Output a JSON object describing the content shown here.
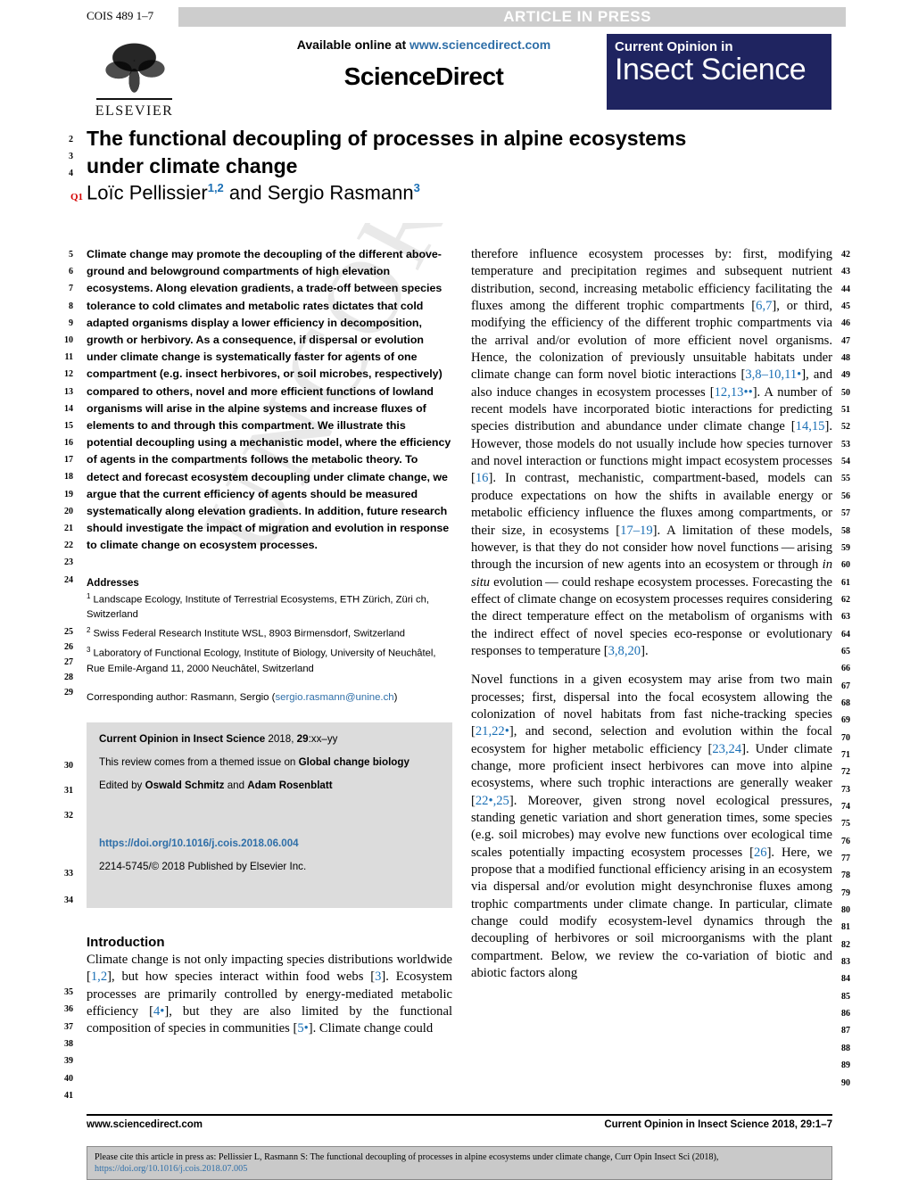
{
  "header": {
    "cois_code": "COIS 489 1–7",
    "article_in_press": "ARTICLE IN PRESS",
    "available_online_prefix": "Available online at ",
    "sciencedirect_url": "www.sciencedirect.com",
    "sciencedirect_wordmark": "ScienceDirect",
    "elsevier_name": "ELSEVIER",
    "journal_logo_line1": "Current Opinion in",
    "journal_logo_line2": "Insect Science",
    "colors": {
      "link_blue": "#2f6fa8",
      "ref_blue": "#1a6fb5",
      "logo_navy": "#1f2460",
      "bar_gray": "#cdcdcd",
      "box_gray": "#dcdcdc",
      "query_red": "#d40000"
    }
  },
  "article": {
    "title": "The functional decoupling of processes in alpine ecosystems under climate change",
    "authors_html": "Loïc Pellissier<sup>1,2</sup> and Sergio Rasmann<sup>3</sup>",
    "query_marker": "Q1",
    "watermark": "UNCORRECTED PROOF"
  },
  "abstract": {
    "text": "Climate change may promote the decoupling of the different above-ground and belowground compartments of high elevation ecosystems. Along elevation gradients, a trade-off between species tolerance to cold climates and metabolic rates dictates that cold adapted organisms display a lower efficiency in decomposition, growth or herbivory. As a consequence, if dispersal or evolution under climate change is systematically faster for agents of one compartment (e.g. insect herbivores, or soil microbes, respectively) compared to others, novel and more efficient functions of lowland organisms will arise in the alpine systems and increase fluxes of elements to and through this compartment. We illustrate this potential decoupling using a mechanistic model, where the efficiency of agents in the compartments follows the metabolic theory. To detect and forecast ecosystem decoupling under climate change, we argue that the current efficiency of agents should be measured systematically along elevation gradients. In addition, future research should investigate the impact of migration and evolution in response to climate change on ecosystem processes."
  },
  "addresses": {
    "heading": "Addresses",
    "items": [
      {
        "sup": "1",
        "text": " Landscape Ecology, Institute of Terrestrial Ecosystems, ETH Zürich, Züri ch, Switzerland"
      },
      {
        "sup": "2",
        "text": " Swiss Federal Research Institute WSL, 8903 Birmensdorf, Switzerland"
      },
      {
        "sup": "3",
        "text": " Laboratory of Functional Ecology, Institute of Biology, University of Neuchâtel, Rue Emile-Argand 11, 2000 Neuchâtel, Switzerland"
      }
    ],
    "corresponding_prefix": "Corresponding author: Rasmann, Sergio (",
    "corresponding_email": "sergio.rasmann@unine.ch",
    "corresponding_suffix": ")"
  },
  "journal_box": {
    "citation_bold": "Current Opinion in Insect Science",
    "citation_rest": " 2018, ",
    "citation_vol": "29",
    "citation_pages": ":xx–yy",
    "themed_prefix": "This review comes from a themed issue on ",
    "themed_bold": "Global change biology",
    "edited_prefix": "Edited by ",
    "editor1": "Oswald Schmitz",
    "edited_join": " and ",
    "editor2": "Adam Rosenblatt",
    "doi": "https://doi.org/10.1016/j.cois.2018.06.004",
    "issn_line": "2214-5745/© 2018 Published by Elsevier Inc."
  },
  "introduction": {
    "heading": "Introduction",
    "paragraph_parts": [
      {
        "t": "Climate change is not only impacting species distributions worldwide ["
      },
      {
        "t": "1,2",
        "ref": true
      },
      {
        "t": "], but how species interact within food webs ["
      },
      {
        "t": "3",
        "ref": true
      },
      {
        "t": "]. Ecosystem processes are primarily controlled by energy-mediated metabolic efficiency ["
      },
      {
        "t": "4•",
        "ref": true
      },
      {
        "t": "], but they are also limited by the functional composition of species in communities ["
      },
      {
        "t": "5•",
        "ref": true
      },
      {
        "t": "]. Climate change could"
      }
    ]
  },
  "right_column": {
    "para1_parts": [
      {
        "t": "therefore influence ecosystem processes by: first, modifying temperature and precipitation regimes and subsequent nutrient distribution, second, increasing metabolic efficiency facilitating the fluxes among the different trophic compartments ["
      },
      {
        "t": "6,7",
        "ref": true
      },
      {
        "t": "], or third, modifying the efficiency of the different trophic compartments via the arrival and/or evolution of more efficient novel organisms. Hence, the colonization of previously unsuitable habitats under climate change can form novel biotic interactions ["
      },
      {
        "t": "3,8–10,11•",
        "ref": true
      },
      {
        "t": "], and also induce changes in ecosystem processes ["
      },
      {
        "t": "12,13••",
        "ref": true
      },
      {
        "t": "]. A number of recent models have incorporated biotic interactions for predicting species distribution and abundance under climate change ["
      },
      {
        "t": "14,15",
        "ref": true
      },
      {
        "t": "]. However, those models do not usually include how species turnover and novel interaction or functions might impact ecosystem processes ["
      },
      {
        "t": "16",
        "ref": true
      },
      {
        "t": "]. In contrast, mechanistic, compartment-based, models can produce expectations on how the shifts in available energy or metabolic efficiency influence the fluxes among compartments, or their size, in ecosystems ["
      },
      {
        "t": "17–19",
        "ref": true
      },
      {
        "t": "]. A limitation of these models, however, is that they do not consider how novel functions — arising through the incursion of new agents into an ecosystem or through "
      },
      {
        "t": "in situ",
        "ital": true
      },
      {
        "t": " evolution — could reshape ecosystem processes. Forecasting the effect of climate change on ecosystem processes requires considering the direct temperature effect on the metabolism of organisms with the indirect effect of novel species eco-response or evolutionary responses to temperature ["
      },
      {
        "t": "3,8,20",
        "ref": true
      },
      {
        "t": "]."
      }
    ],
    "para2_parts": [
      {
        "t": "Novel functions in a given ecosystem may arise from two main processes; first, dispersal into the focal ecosystem allowing the colonization of novel habitats from fast niche-tracking species ["
      },
      {
        "t": "21,22•",
        "ref": true
      },
      {
        "t": "], and second, selection and evolution within the focal ecosystem for higher metabolic efficiency ["
      },
      {
        "t": "23,24",
        "ref": true
      },
      {
        "t": "]. Under climate change, more proficient insect herbivores can move into alpine ecosystems, where such trophic interactions are generally weaker ["
      },
      {
        "t": "22•,25",
        "ref": true
      },
      {
        "t": "]. Moreover, given strong novel ecological pressures, standing genetic variation and short generation times, some species (e.g. soil microbes) may evolve new functions over ecological time scales potentially impacting ecosystem processes ["
      },
      {
        "t": "26",
        "ref": true
      },
      {
        "t": "]. Here, we propose that a modified functional efficiency arising in an ecosystem via dispersal and/or evolution might desynchronise fluxes among trophic compartments under climate change. In particular, climate change could modify ecosystem-level dynamics through the decoupling of herbivores or soil microorganisms with the plant compartment. Below, we review the co-variation of biotic and abiotic factors along"
      }
    ]
  },
  "line_numbers": {
    "title_block": [
      "2",
      "3",
      "4"
    ],
    "left_abstract": [
      "5",
      "6",
      "7",
      "8",
      "9",
      "10",
      "11",
      "12",
      "13",
      "14",
      "15",
      "16",
      "17",
      "18",
      "19",
      "20",
      "21",
      "22",
      "23",
      "24"
    ],
    "left_addresses": [
      "25",
      "26",
      "27",
      "28",
      "29"
    ],
    "left_graybox": [
      "30",
      "31",
      "32"
    ],
    "left_doi": [
      "33",
      "34"
    ],
    "left_intro": [
      "35",
      "36",
      "37",
      "38",
      "39",
      "40",
      "41"
    ],
    "right": [
      "42",
      "43",
      "44",
      "45",
      "46",
      "47",
      "48",
      "49",
      "50",
      "51",
      "52",
      "53",
      "54",
      "55",
      "56",
      "57",
      "58",
      "59",
      "60",
      "61",
      "62",
      "63",
      "64",
      "65",
      "66",
      "67",
      "68",
      "69",
      "70",
      "71",
      "72",
      "73",
      "74",
      "75",
      "76",
      "77",
      "78",
      "79",
      "80",
      "81",
      "82",
      "83",
      "84",
      "85",
      "86",
      "87",
      "88",
      "89",
      "90"
    ]
  },
  "footer": {
    "left": "www.sciencedirect.com",
    "right_bold": "Current Opinion in Insect Science",
    "right_rest": " 2018, ",
    "right_vol": "29",
    "right_pages": ":1–7",
    "cite_prefix": "Please cite this article in press as: Pellissier L, Rasmann  S: The functional decoupling of processes in alpine ecosystems under climate change, Curr Opin Insect Sci (2018), ",
    "cite_link": "https://doi.org/10.1016/j.cois.2018.07.005"
  }
}
